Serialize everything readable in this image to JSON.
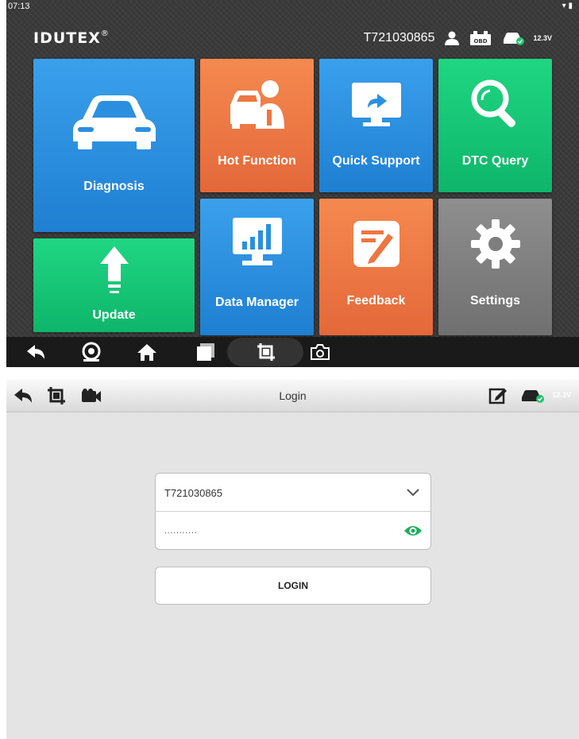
{
  "status_bar": {
    "time": "07:13",
    "icons": [
      "wifi-icon",
      "battery-icon"
    ]
  },
  "header": {
    "brand": "IDUTEX",
    "brand_mark": "®",
    "serial": "T721030865",
    "obd_label": "OBD",
    "voltage": "12.3V"
  },
  "tiles": [
    {
      "id": "diagnosis",
      "label": "Diagnosis",
      "color": "#2b8fe0",
      "icon": "car-icon"
    },
    {
      "id": "hot-function",
      "label": "Hot Function",
      "color": "#ee7641",
      "icon": "car-wrench-icon"
    },
    {
      "id": "quick-support",
      "label": "Quick Support",
      "color": "#2b8fe0",
      "icon": "remote-support-icon"
    },
    {
      "id": "dtc-query",
      "label": "DTC Query",
      "color": "#14c774",
      "icon": "magnifier-icon"
    },
    {
      "id": "update",
      "label": "Update",
      "color": "#14c774",
      "icon": "update-arrow-icon"
    },
    {
      "id": "data-manager",
      "label": "Data Manager",
      "color": "#2b8fe0",
      "icon": "bar-chart-icon"
    },
    {
      "id": "feedback",
      "label": "Feedback",
      "color": "#ee7641",
      "icon": "edit-note-icon"
    },
    {
      "id": "settings",
      "label": "Settings",
      "color": "#7e7e7e",
      "icon": "gear-icon"
    }
  ],
  "navbar": [
    "back-icon",
    "tire-icon",
    "home-icon",
    "recent-apps-icon",
    "screenshot-crop-icon",
    "camera-icon"
  ],
  "login": {
    "title": "Login",
    "voltage": "12.3V",
    "username_value": "T721030865",
    "password_value": "...........",
    "button_label": "LOGIN"
  }
}
